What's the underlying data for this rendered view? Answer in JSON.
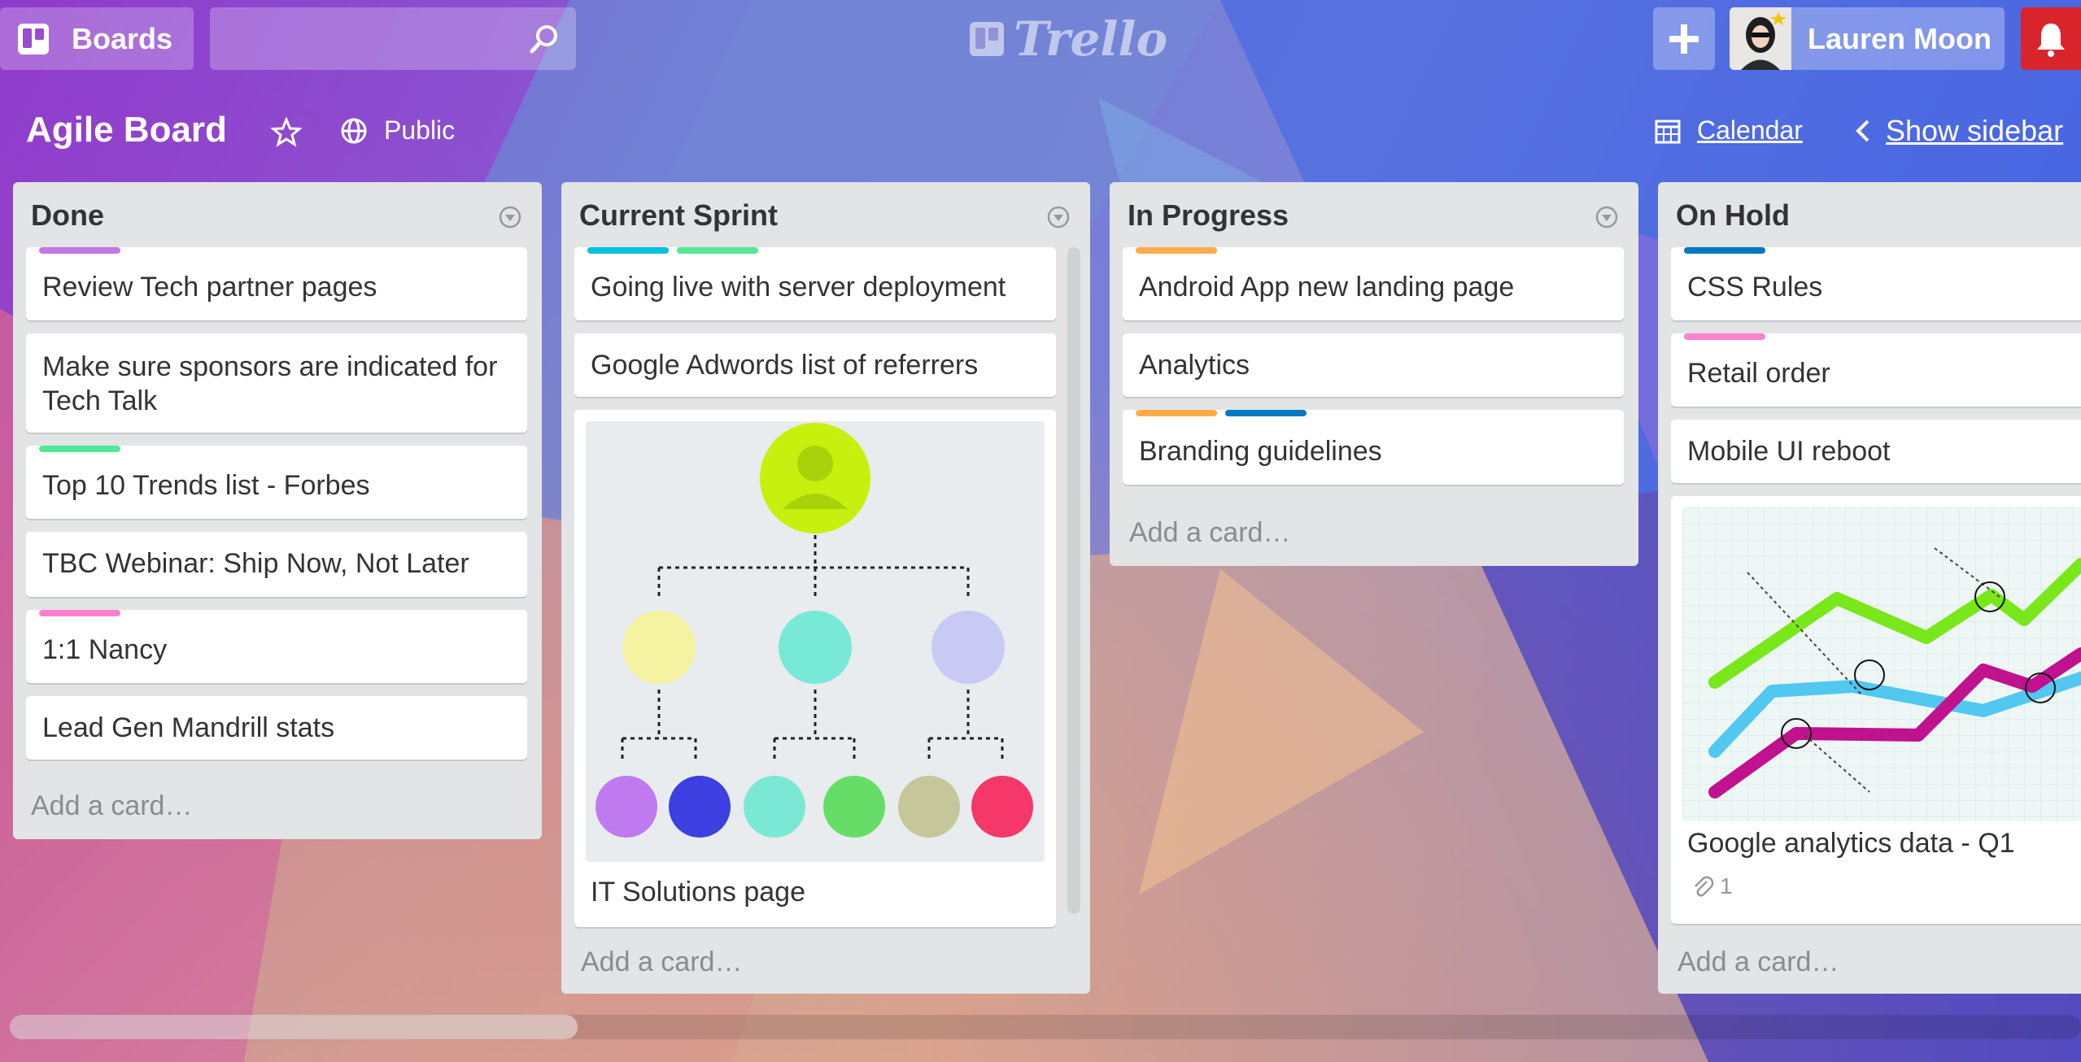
{
  "topbar": {
    "boards_label": "Boards",
    "search_placeholder": "",
    "logo_text": "Trello",
    "user_name": "Lauren Moon"
  },
  "board": {
    "title": "Agile Board",
    "visibility": "Public",
    "calendar_label": "Calendar",
    "sidebar_label": "Show sidebar"
  },
  "lists": [
    {
      "title": "Done",
      "cards": [
        {
          "title": "Review Tech partner pages",
          "labels": [
            "#c377e0"
          ]
        },
        {
          "title": "Make sure sponsors are indicated for Tech Talk",
          "labels": []
        },
        {
          "title": "Top 10 Trends list - Forbes",
          "labels": [
            "#51e898"
          ]
        },
        {
          "title": "TBC Webinar: Ship Now, Not Later",
          "labels": []
        },
        {
          "title": "1:1 Nancy",
          "labels": [
            "#ff80ce"
          ]
        },
        {
          "title": "Lead Gen Mandrill stats",
          "labels": []
        }
      ],
      "add_card": "Add a card…"
    },
    {
      "title": "Current Sprint",
      "cards": [
        {
          "title": "Going live with server deployment",
          "labels": [
            "#00c2e0",
            "#51e898"
          ]
        },
        {
          "title": "Google Adwords list of referrers",
          "labels": []
        },
        {
          "title": "IT Solutions page",
          "labels": [],
          "has_cover": true
        }
      ],
      "add_card": "Add a card…"
    },
    {
      "title": "In Progress",
      "cards": [
        {
          "title": "Android App new landing page",
          "labels": [
            "#ffab4a"
          ]
        },
        {
          "title": "Analytics",
          "labels": []
        },
        {
          "title": "Branding guidelines",
          "labels": [
            "#ffab4a",
            "#0079bf"
          ]
        }
      ],
      "add_card": "Add a card…"
    },
    {
      "title": "On Hold",
      "cards": [
        {
          "title": "CSS Rules",
          "labels": [
            "#0079bf"
          ]
        },
        {
          "title": "Retail order",
          "labels": [
            "#ff80ce"
          ]
        },
        {
          "title": "Mobile UI reboot",
          "labels": []
        },
        {
          "title": "Google analytics data - Q1",
          "labels": [],
          "has_cover": true,
          "attachments": "1"
        }
      ],
      "add_card": "Add a card…"
    }
  ],
  "colors": {
    "list_bg": "#e2e4e6",
    "notification_red": "#d9242b",
    "purple": "#c377e0",
    "green": "#51e898",
    "pink": "#ff80ce",
    "sky": "#00c2e0",
    "orange": "#ffab4a",
    "blue": "#0079bf"
  }
}
